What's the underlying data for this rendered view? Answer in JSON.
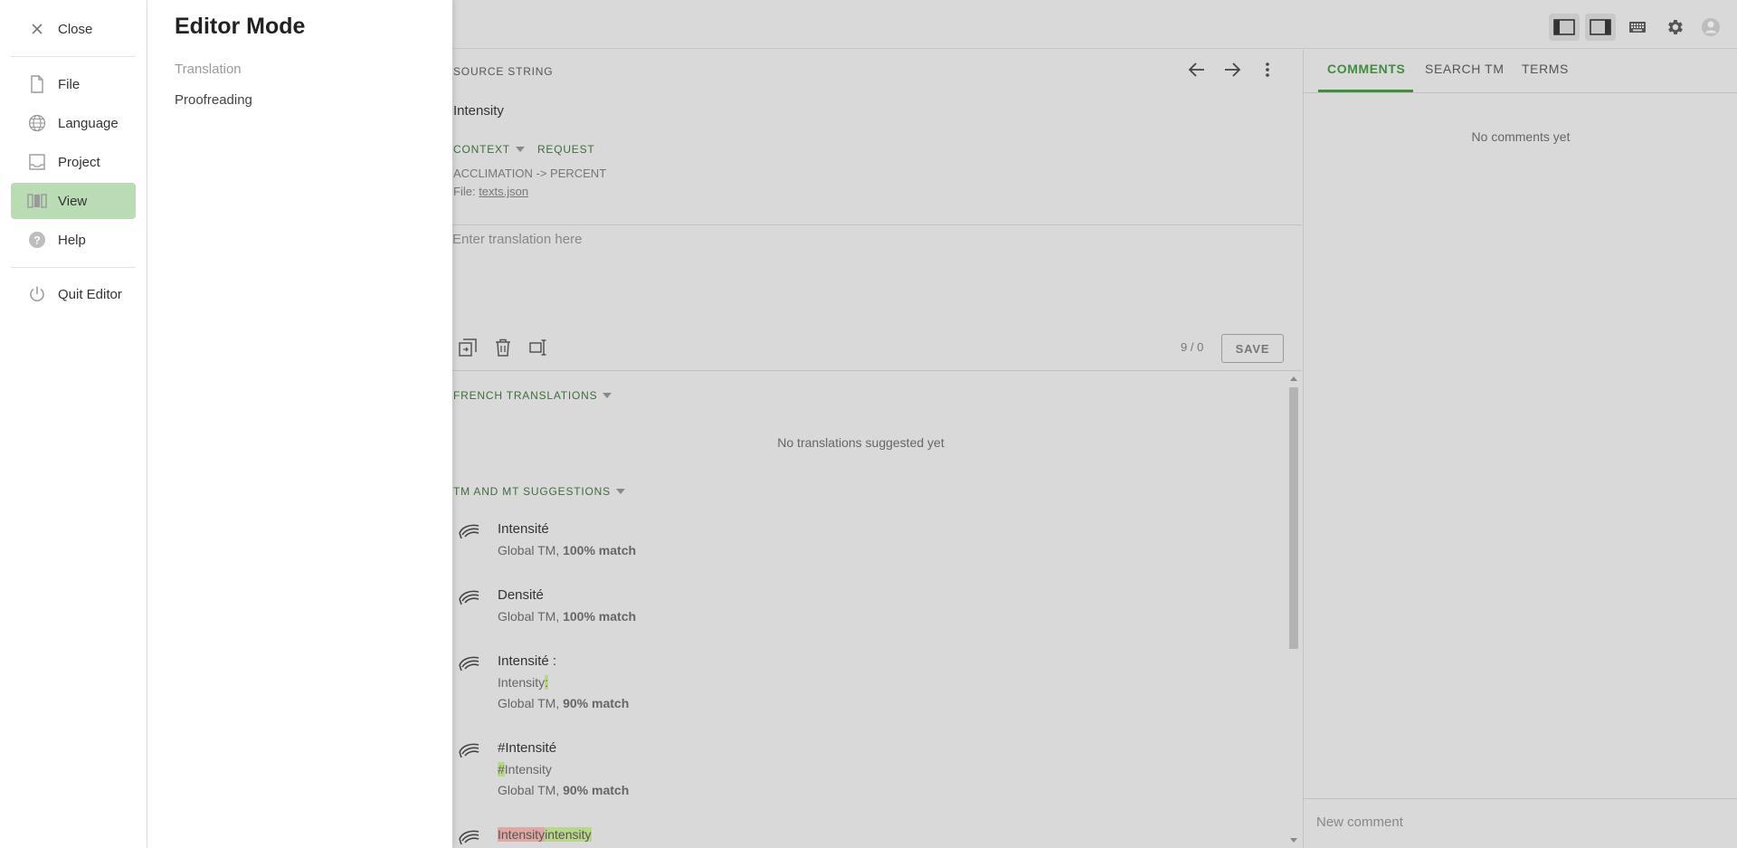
{
  "nav": {
    "close": "Close",
    "items": [
      {
        "label": "File",
        "icon": "file-icon"
      },
      {
        "label": "Language",
        "icon": "globe-icon"
      },
      {
        "label": "Project",
        "icon": "project-icon"
      },
      {
        "label": "View",
        "icon": "view-icon"
      },
      {
        "label": "Help",
        "icon": "help-icon"
      }
    ],
    "quit": "Quit Editor"
  },
  "mode": {
    "title": "Editor Mode",
    "options": [
      "Translation",
      "Proofreading"
    ]
  },
  "source": {
    "label": "SOURCE STRING",
    "text": "Intensity",
    "context_label": "CONTEXT",
    "request_label": "REQUEST",
    "context_value": "ACCLIMATION -> PERCENT",
    "file_prefix": "File:",
    "file_name": "texts.json"
  },
  "editor": {
    "placeholder": "Enter translation here",
    "counter": "9 / 0",
    "save": "SAVE"
  },
  "translations": {
    "french_header": "FRENCH TRANSLATIONS",
    "empty": "No translations suggested yet",
    "tm_header": "TM AND MT SUGGESTIONS",
    "suggestions": [
      {
        "text": "Intensité",
        "source_text": "",
        "origin": "Global TM,",
        "match": "100% match"
      },
      {
        "text": "Densité",
        "source_text": "",
        "origin": "Global TM,",
        "match": "100% match"
      },
      {
        "text": "Intensité :",
        "source_text": "Intensity",
        "source_diff": ":",
        "origin": "Global TM,",
        "match": "90% match"
      },
      {
        "text": "#Intensité",
        "source_diff": "#",
        "source_text": "Intensity",
        "origin": "Global TM,",
        "match": "90% match"
      },
      {
        "del": "Intensity",
        "ins": "intensity"
      }
    ]
  },
  "right": {
    "tabs": [
      "COMMENTS",
      "SEARCH TM",
      "TERMS"
    ],
    "empty": "No comments yet",
    "new_comment": "New comment"
  },
  "colors": {
    "accent": "#3e8e3e",
    "nav_active": "#b9dcb5",
    "overlay_bg": "#d9d9d9"
  }
}
